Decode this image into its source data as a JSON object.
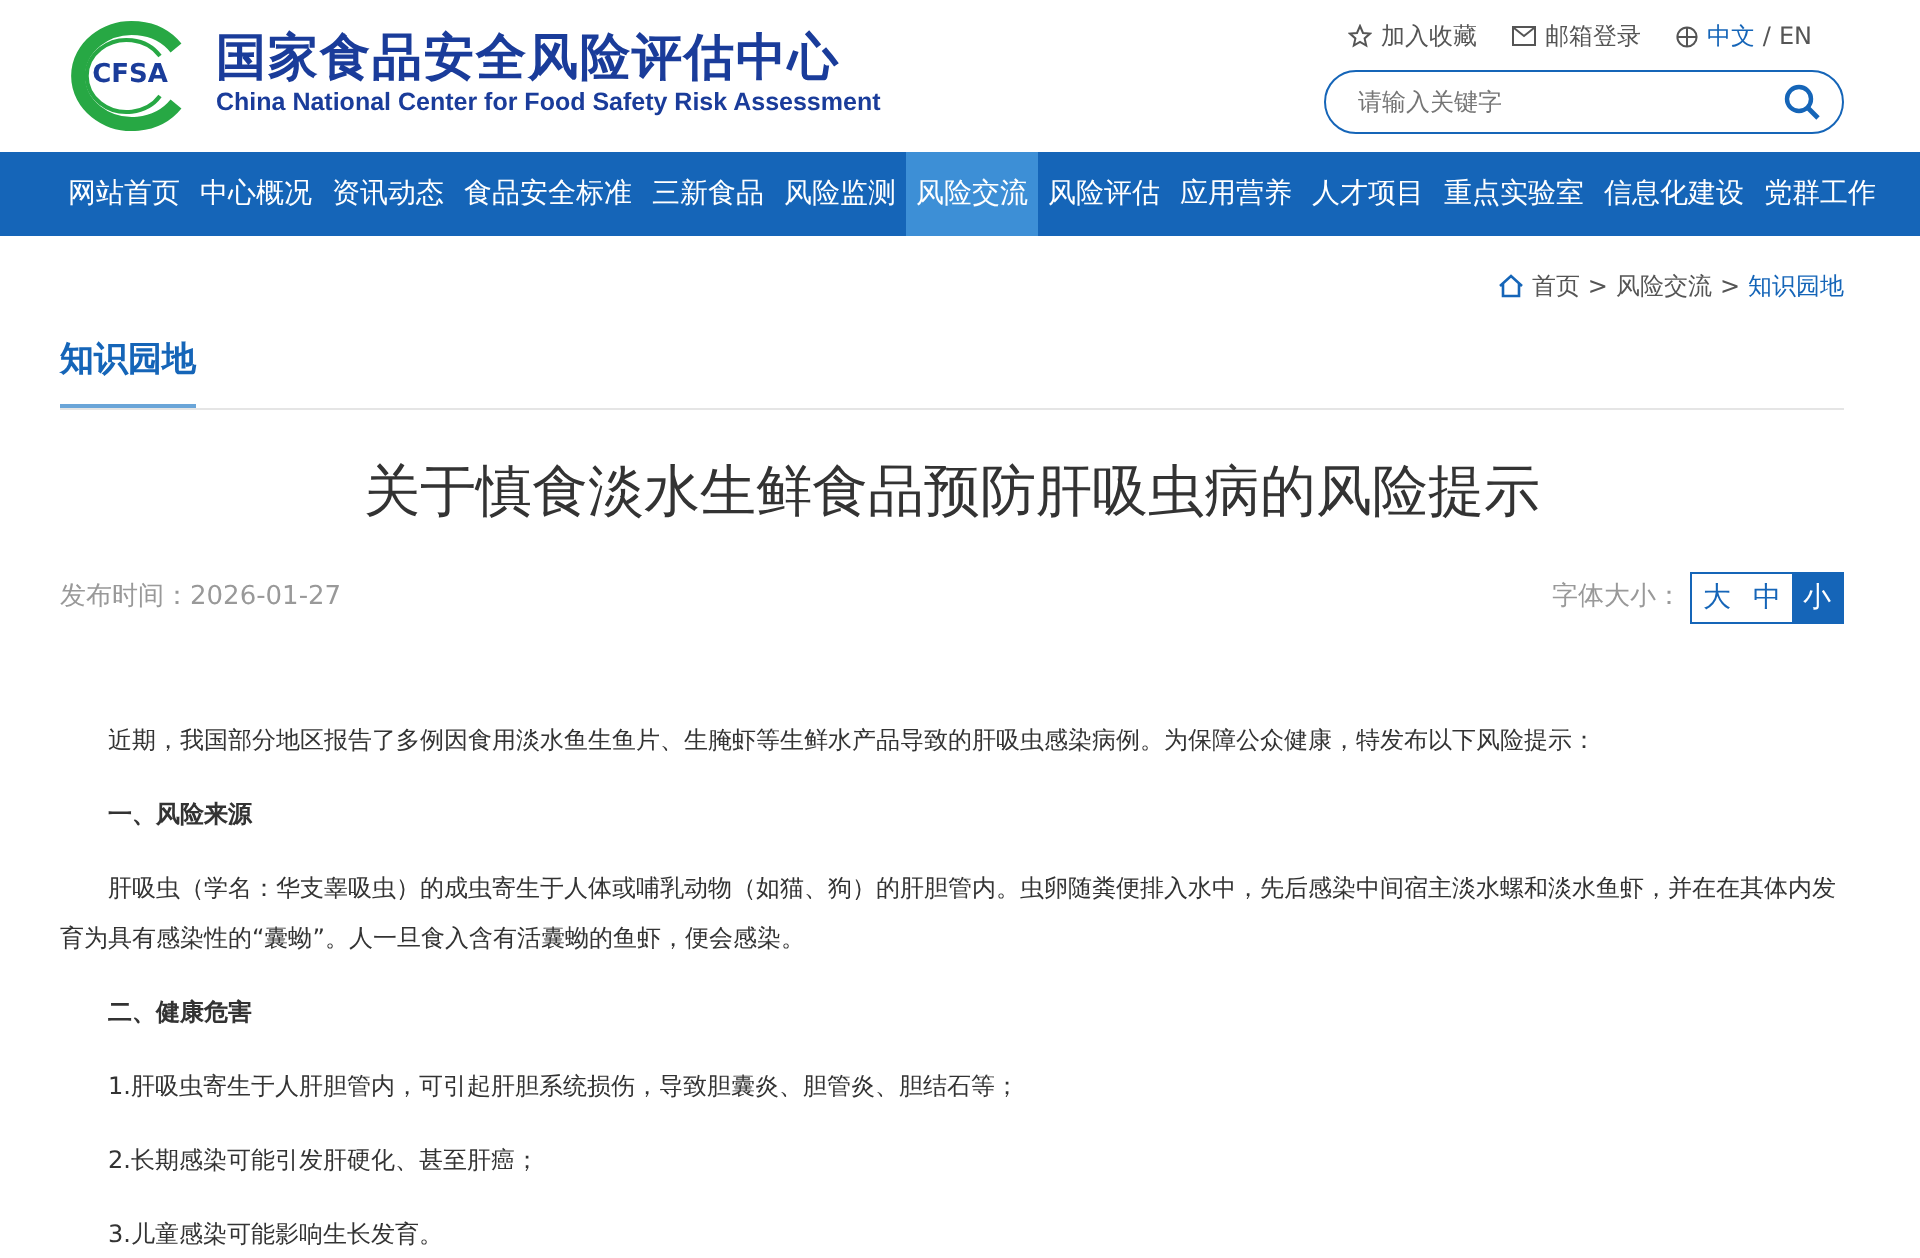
{
  "logo": {
    "mark": "CFSA",
    "title": "国家食品安全风险评估中心",
    "subtitle": "China National Center for Food Safety Risk Assessment"
  },
  "top_links": [
    {
      "kind": "star",
      "label": "加入收藏"
    },
    {
      "kind": "mail",
      "label": "邮箱登录"
    },
    {
      "kind": "lang",
      "label": "中文",
      "selected": true
    },
    {
      "kind": "lang",
      "label": "EN",
      "selected": false
    }
  ],
  "lang_separator": "/",
  "breadcrumb_separator": ">",
  "search": {
    "placeholder": "请输入关键字"
  },
  "nav": [
    {
      "label": "网站首页",
      "selected": false
    },
    {
      "label": "中心概况",
      "selected": false
    },
    {
      "label": "资讯动态",
      "selected": false
    },
    {
      "label": "食品安全标准",
      "selected": false
    },
    {
      "label": "三新食品",
      "selected": false
    },
    {
      "label": "风险监测",
      "selected": false
    },
    {
      "label": "风险交流",
      "selected": true
    },
    {
      "label": "风险评估",
      "selected": false
    },
    {
      "label": "应用营养",
      "selected": false
    },
    {
      "label": "人才项目",
      "selected": false
    },
    {
      "label": "重点实验室",
      "selected": false
    },
    {
      "label": "信息化建设",
      "selected": false
    },
    {
      "label": "党群工作",
      "selected": false
    }
  ],
  "breadcrumb": [
    {
      "label": "首页",
      "current": false
    },
    {
      "label": "风险交流",
      "current": false
    },
    {
      "label": "知识园地",
      "current": true
    }
  ],
  "section_title": "知识园地",
  "article": {
    "title": "关于慎食淡水生鲜食品预防肝吸虫病的风险提示",
    "published": "发布时间：2026-01-27",
    "font_size_label": "字体大小：",
    "font_sizes": [
      {
        "label": "大",
        "selected": false
      },
      {
        "label": "中",
        "selected": false
      },
      {
        "label": "小",
        "selected": true
      }
    ],
    "body": [
      {
        "kind": "paragraph",
        "text": "近期，我国部分地区报告了多例因食用淡水鱼生鱼片、生腌虾等生鲜水产品导致的肝吸虫感染病例。为保障公众健康，特发布以下风险提示："
      },
      {
        "kind": "heading",
        "text": "一、风险来源"
      },
      {
        "kind": "paragraph",
        "text": "肝吸虫（学名：华支睾吸虫）的成虫寄生于人体或哺乳动物（如猫、狗）的肝胆管内。虫卵随粪便排入水中，先后感染中间宿主淡水螺和淡水鱼虾，并在在其体内发育为具有感染性的“囊蚴”。人一旦食入含有活囊蚴的鱼虾，便会感染。"
      },
      {
        "kind": "heading",
        "text": "二、健康危害"
      },
      {
        "kind": "item",
        "text": "1.肝吸虫寄生于人肝胆管内，可引起肝胆系统损伤，导致胆囊炎、胆管炎、胆结石等；"
      },
      {
        "kind": "item",
        "text": "2.长期感染可能引发肝硬化、甚至肝癌；"
      },
      {
        "kind": "item",
        "text": "3.儿童感染可能影响生长发育。"
      }
    ]
  }
}
